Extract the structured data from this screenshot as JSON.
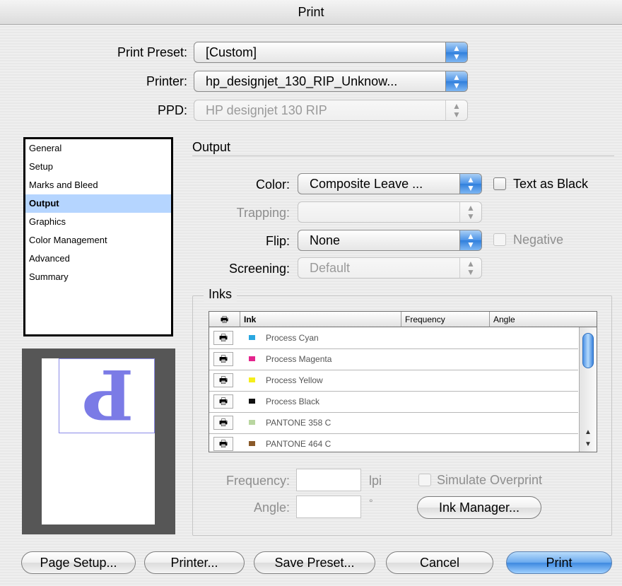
{
  "window": {
    "title": "Print"
  },
  "top": {
    "print_preset": {
      "label": "Print Preset:",
      "value": "[Custom]"
    },
    "printer": {
      "label": "Printer:",
      "value": "hp_designjet_130_RIP_Unknow..."
    },
    "ppd": {
      "label": "PPD:",
      "value": "HP designjet 130 RIP"
    }
  },
  "sidebar": {
    "items": [
      {
        "label": "General"
      },
      {
        "label": "Setup"
      },
      {
        "label": "Marks and Bleed"
      },
      {
        "label": "Output",
        "selected": true
      },
      {
        "label": "Graphics"
      },
      {
        "label": "Color Management"
      },
      {
        "label": "Advanced"
      },
      {
        "label": "Summary"
      }
    ]
  },
  "preview": {
    "glyph": "P"
  },
  "output": {
    "heading": "Output",
    "color": {
      "label": "Color:",
      "value": "Composite Leave ..."
    },
    "text_as_black": {
      "label": "Text as Black",
      "checked": false
    },
    "trapping": {
      "label": "Trapping:",
      "value": ""
    },
    "flip": {
      "label": "Flip:",
      "value": "None"
    },
    "negative": {
      "label": "Negative",
      "checked": false
    },
    "screening": {
      "label": "Screening:",
      "value": "Default"
    }
  },
  "inks": {
    "heading": "Inks",
    "columns": [
      "Ink",
      "Frequency",
      "Angle"
    ],
    "rows": [
      {
        "name": "Process Cyan",
        "color": "#2aa7e0"
      },
      {
        "name": "Process Magenta",
        "color": "#e4248d"
      },
      {
        "name": "Process Yellow",
        "color": "#f5ee1d"
      },
      {
        "name": "Process Black",
        "color": "#111111"
      },
      {
        "name": "PANTONE 358 C",
        "color": "#b9d6a0"
      },
      {
        "name": "PANTONE 464 C",
        "color": "#8a5a2a"
      }
    ],
    "frequency": {
      "label": "Frequency:",
      "unit": "lpi",
      "value": ""
    },
    "angle": {
      "label": "Angle:",
      "unit": "°",
      "value": ""
    },
    "simulate_overprint": {
      "label": "Simulate Overprint",
      "checked": false
    },
    "ink_manager": "Ink Manager..."
  },
  "buttons": {
    "page_setup": "Page Setup...",
    "printer": "Printer...",
    "save_preset": "Save Preset...",
    "cancel": "Cancel",
    "print": "Print"
  },
  "colors": {
    "selection": "#b5d5ff",
    "default_button": "#3d88e0",
    "preview_glyph": "#7b7be6"
  }
}
